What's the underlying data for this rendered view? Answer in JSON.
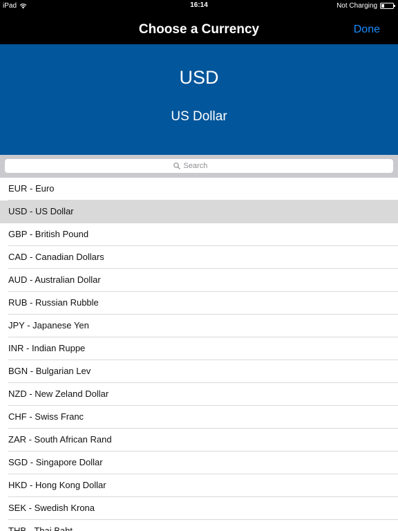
{
  "status_bar": {
    "device": "iPad",
    "time": "16:14",
    "charging": "Not Charging",
    "wifi_icon": "wifi-icon",
    "battery_icon": "battery-icon"
  },
  "nav": {
    "title": "Choose a Currency",
    "done_label": "Done"
  },
  "selection": {
    "code": "USD",
    "name": "US Dollar"
  },
  "search": {
    "placeholder": "Search",
    "icon": "search-icon"
  },
  "colors": {
    "panel_blue": "#02569b",
    "done_blue": "#1a8cff",
    "selected_row": "#d9d9d9"
  },
  "currencies": [
    {
      "label": "EUR - Euro",
      "selected": false
    },
    {
      "label": "USD - US Dollar",
      "selected": true
    },
    {
      "label": "GBP - British Pound",
      "selected": false
    },
    {
      "label": "CAD - Canadian Dollars",
      "selected": false
    },
    {
      "label": "AUD - Australian Dollar",
      "selected": false
    },
    {
      "label": "RUB - Russian Rubble",
      "selected": false
    },
    {
      "label": "JPY - Japanese Yen",
      "selected": false
    },
    {
      "label": "INR - Indian Ruppe",
      "selected": false
    },
    {
      "label": "BGN - Bulgarian Lev",
      "selected": false
    },
    {
      "label": "NZD - New Zeland Dollar",
      "selected": false
    },
    {
      "label": "CHF - Swiss Franc",
      "selected": false
    },
    {
      "label": "ZAR - South African Rand",
      "selected": false
    },
    {
      "label": "SGD - Singapore Dollar",
      "selected": false
    },
    {
      "label": "HKD - Hong Kong Dollar",
      "selected": false
    },
    {
      "label": "SEK - Swedish Krona",
      "selected": false
    },
    {
      "label": "THB - Thai Baht",
      "selected": false
    }
  ]
}
